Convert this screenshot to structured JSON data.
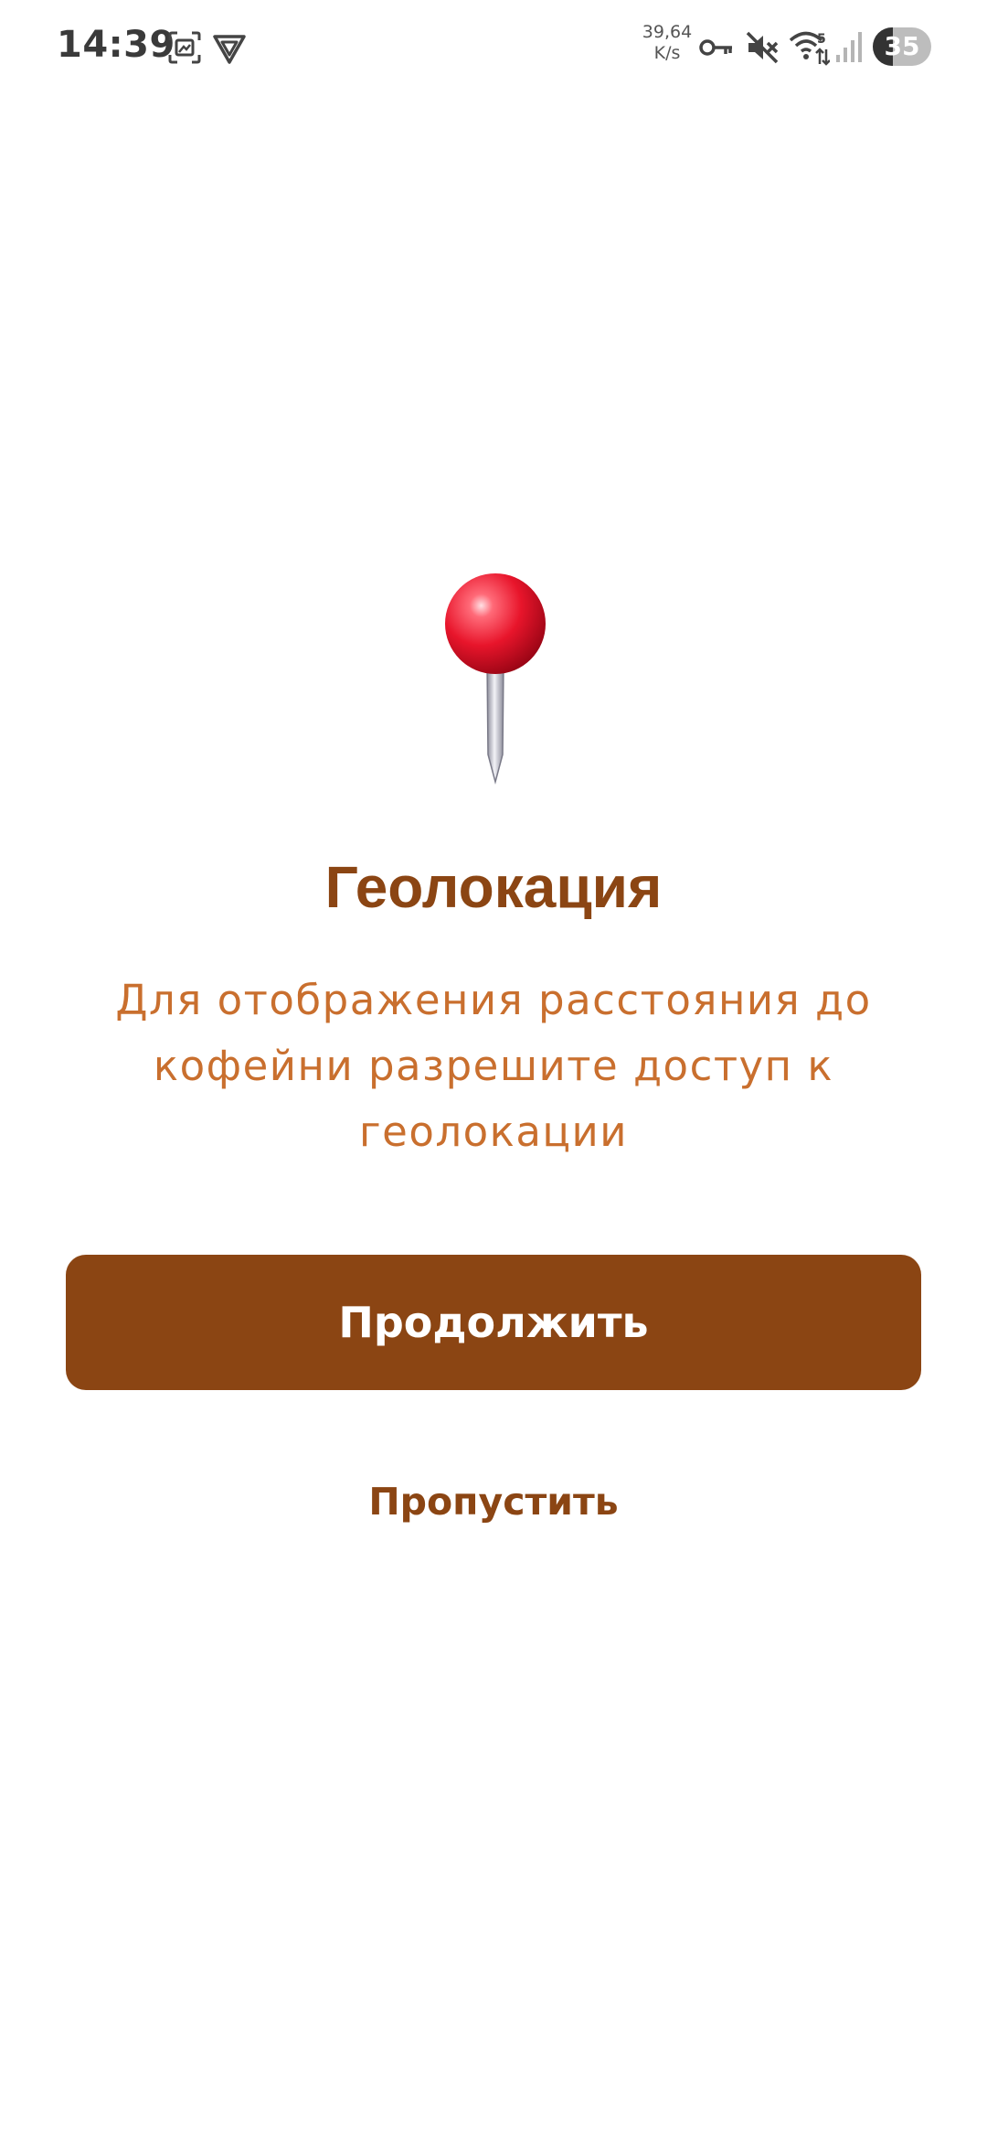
{
  "status_bar": {
    "time": "14:39",
    "net_speed_value": "39,64",
    "net_speed_unit": "K/s",
    "battery_level": "35",
    "icons": [
      "screenshot-icon",
      "vpn-app-icon",
      "key-icon",
      "mute-icon",
      "wifi-icon",
      "signal-icon",
      "battery-icon"
    ]
  },
  "main": {
    "icon": "round-pushpin-icon",
    "title": "Геолокация",
    "description": "Для отображения расстояния до кофейни разрешите доступ к геолокации",
    "continue_label": "Продолжить",
    "skip_label": "Пропустить"
  },
  "colors": {
    "brand": "#8B4513",
    "description_text": "#C96F2E",
    "background": "#FFFFFF",
    "button_text": "#FFFFFF"
  }
}
